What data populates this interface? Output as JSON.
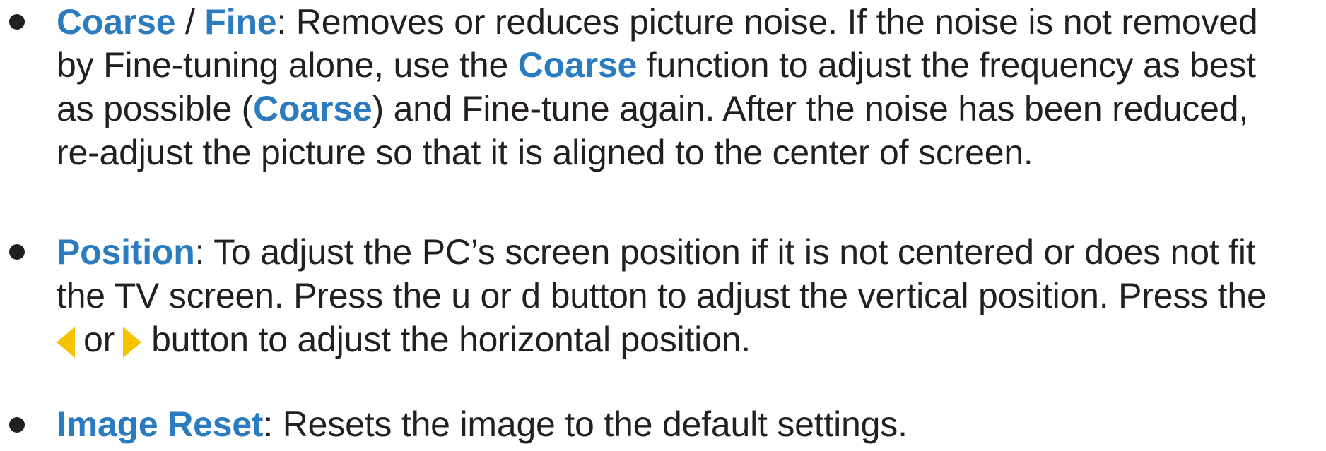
{
  "items": [
    {
      "keywords": [
        "Coarse",
        "Fine"
      ],
      "separator": " / ",
      "lines": {
        "l1_rest": ": Removes or reduces picture noise. If the noise is not removed",
        "l2_a": "by Fine-tuning alone, use the ",
        "l2_kw": "Coarse",
        "l2_b": " function to adjust the frequency as best",
        "l3_a": "as possible (",
        "l3_kw": "Coarse",
        "l3_b": ") and Fine-tune again. After the noise has been reduced,",
        "l4": "re-adjust the picture so that it is aligned to the center of screen."
      }
    },
    {
      "keyword": "Position",
      "lines": {
        "l1_rest": ": To adjust the PC’s screen position if it is not centered or does not fit",
        "l2": "the TV screen. Press the u or d button to adjust the vertical position. Press the",
        "l3_or": "or",
        "l3_rest": "button to adjust the horizontal position."
      },
      "icons": [
        "left-arrow-icon",
        "right-arrow-icon"
      ],
      "icon_color": "#f5c400"
    },
    {
      "keyword": "Image Reset",
      "lines": {
        "l1_rest": ": Resets the image to the default settings."
      }
    }
  ],
  "colors": {
    "keyword": "#2b7bc0",
    "text": "#231f20",
    "arrow": "#f5c400"
  }
}
